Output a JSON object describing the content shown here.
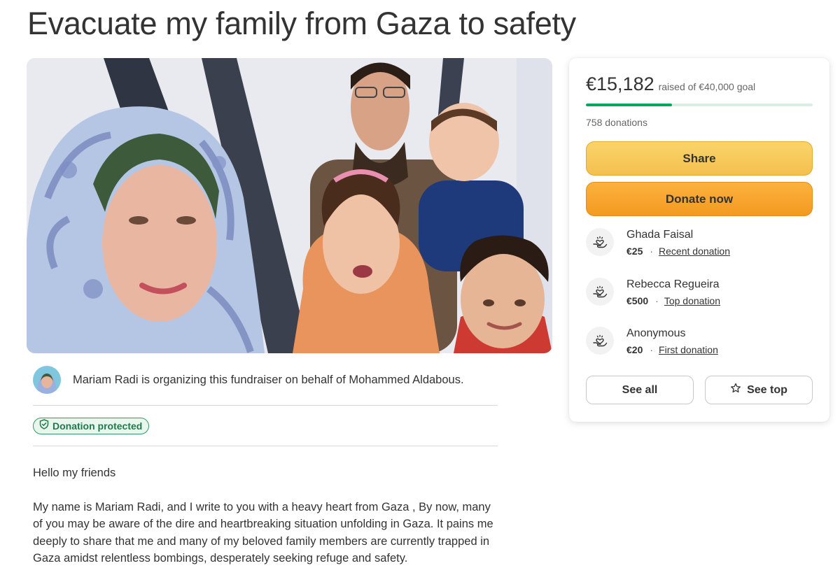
{
  "page": {
    "title": "Evacuate my family from Gaza to safety"
  },
  "organizer": {
    "text": "Mariam Radi is organizing this fundraiser on behalf of Mohammed Aldabous."
  },
  "badge": {
    "label": "Donation protected"
  },
  "story": {
    "paragraphs": [
      "Hello my friends",
      "My name is Mariam Radi, and I write to you with a heavy heart from Gaza , By now, many of you may be aware of the dire and heartbreaking situation unfolding in Gaza. It pains me deeply to share that me and many of my beloved family members are currently trapped in Gaza amidst relentless bombings, desperately seeking refuge and safety."
    ]
  },
  "sidebar": {
    "raised": "€15,182",
    "goal_text": "raised of €40,000 goal",
    "progress_fraction": 0.3795,
    "donation_count": "758 donations",
    "share_label": "Share",
    "donate_label": "Donate now",
    "donors": [
      {
        "name": "Ghada Faisal",
        "amount": "€25",
        "tag": "Recent donation"
      },
      {
        "name": "Rebecca Regueira",
        "amount": "€500",
        "tag": "Top donation"
      },
      {
        "name": "Anonymous",
        "amount": "€20",
        "tag": "First donation"
      }
    ],
    "see_all_label": "See all",
    "see_top_label": "See top"
  },
  "colors": {
    "progress": "#02a95c",
    "share_button": "#f6c95a",
    "donate_button": "#f7a52e",
    "protected_green": "#1f7a4a"
  },
  "icons": {
    "badge": "shield-check-icon",
    "donor": "donation-heart-icon",
    "see_top": "star-icon"
  }
}
